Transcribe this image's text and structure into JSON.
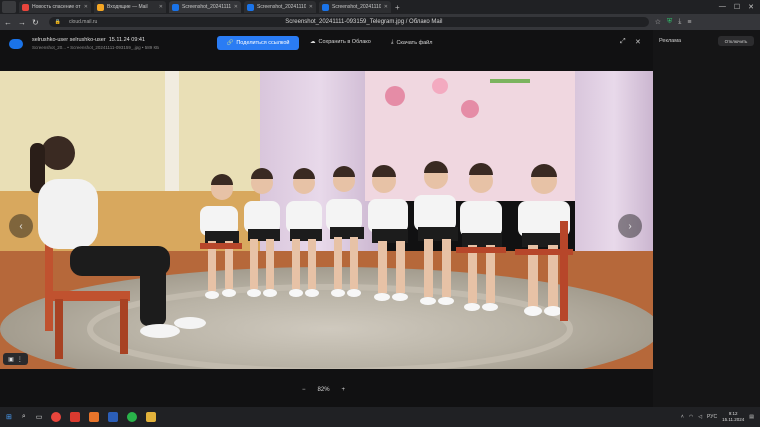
{
  "browser": {
    "tabs": [
      {
        "title": "Новость спасение от ...",
        "color": "#e8453c",
        "active": false
      },
      {
        "title": "Входящие — Mail",
        "color": "#f5a623",
        "active": false
      },
      {
        "title": "Screenshot_20241111-0...",
        "color": "#1a73e8",
        "active": true
      },
      {
        "title": "Screenshot_20241110-01...",
        "color": "#1a73e8",
        "active": false
      },
      {
        "title": "Screenshot_20241110-01...",
        "color": "#1a73e8",
        "active": false
      }
    ],
    "new_tab": "+",
    "address": {
      "domain": "cloud.mail.ru",
      "title": "Screenshot_20241111-093159_Telegram.jpg / Облако Mail"
    }
  },
  "viewer_header": {
    "folder": "selrushko-user selrushko-user",
    "date": "15.11.24 09:41",
    "file": "Screenshot_20... • Screenshot_20241111-093159_.jpg • 589 КБ",
    "share_label": "Поделиться ссылкой",
    "save_label": "Сохранить в Облако",
    "download_label": "Скачать файл"
  },
  "side_panel": {
    "ad_label": "Реклама",
    "close_label": "Отключить"
  },
  "viewer": {
    "zoom_minus": "−",
    "zoom_value": "82%",
    "zoom_plus": "+",
    "prev": "‹",
    "next": "›"
  },
  "taskbar": {
    "lang": "РУС",
    "time": "9:12",
    "date": "15.11.2024"
  },
  "colors": {
    "accent": "#2a7cf4",
    "background": "#111112"
  }
}
